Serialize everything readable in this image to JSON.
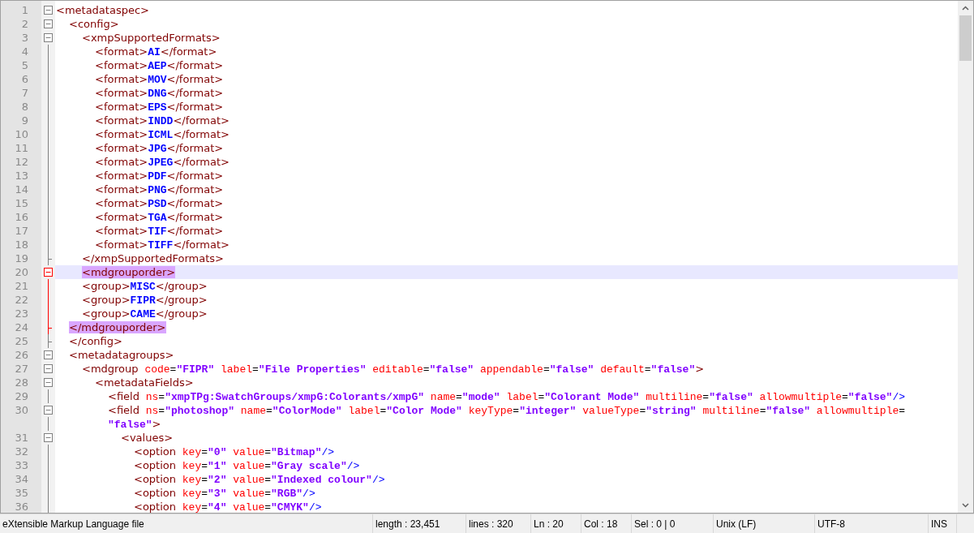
{
  "lines": [
    {
      "number": "1",
      "kind": "fold-open",
      "active": false,
      "selected": false,
      "tokens": [
        {
          "kind": "tag",
          "text": "<metadataspec>"
        }
      ],
      "children": [
        {
          "number": "2",
          "kind": "fold-open",
          "active": false,
          "selected": false,
          "tokens": [
            {
              "kind": "tag",
              "text": "<config>"
            }
          ],
          "children": [
            {
              "number": "3",
              "kind": "fold-open",
              "active": false,
              "selected": false,
              "tokens": [
                {
                  "kind": "tag",
                  "text": "<xmpSupportedFormats>"
                }
              ],
              "children": [
                {
                  "number": "4",
                  "kind": "fold-line",
                  "active": false,
                  "selected": false,
                  "tokens": [
                    {
                      "kind": "tag",
                      "text": "<format>"
                    },
                    {
                      "kind": "text",
                      "text": "AI"
                    },
                    {
                      "kind": "tag",
                      "text": "</format>"
                    }
                  ]
                },
                {
                  "number": "5",
                  "kind": "fold-line",
                  "active": false,
                  "selected": false,
                  "tokens": [
                    {
                      "kind": "tag",
                      "text": "<format>"
                    },
                    {
                      "kind": "text",
                      "text": "AEP"
                    },
                    {
                      "kind": "tag",
                      "text": "</format>"
                    }
                  ]
                },
                {
                  "number": "6",
                  "kind": "fold-line",
                  "active": false,
                  "selected": false,
                  "tokens": [
                    {
                      "kind": "tag",
                      "text": "<format>"
                    },
                    {
                      "kind": "text",
                      "text": "MOV"
                    },
                    {
                      "kind": "tag",
                      "text": "</format>"
                    }
                  ]
                },
                {
                  "number": "7",
                  "kind": "fold-line",
                  "active": false,
                  "selected": false,
                  "tokens": [
                    {
                      "kind": "tag",
                      "text": "<format>"
                    },
                    {
                      "kind": "text",
                      "text": "DNG"
                    },
                    {
                      "kind": "tag",
                      "text": "</format>"
                    }
                  ]
                },
                {
                  "number": "8",
                  "kind": "fold-line",
                  "active": false,
                  "selected": false,
                  "tokens": [
                    {
                      "kind": "tag",
                      "text": "<format>"
                    },
                    {
                      "kind": "text",
                      "text": "EPS"
                    },
                    {
                      "kind": "tag",
                      "text": "</format>"
                    }
                  ]
                },
                {
                  "number": "9",
                  "kind": "fold-line",
                  "active": false,
                  "selected": false,
                  "tokens": [
                    {
                      "kind": "tag",
                      "text": "<format>"
                    },
                    {
                      "kind": "text",
                      "text": "INDD"
                    },
                    {
                      "kind": "tag",
                      "text": "</format>"
                    }
                  ]
                },
                {
                  "number": "10",
                  "kind": "fold-line",
                  "active": false,
                  "selected": false,
                  "tokens": [
                    {
                      "kind": "tag",
                      "text": "<format>"
                    },
                    {
                      "kind": "text",
                      "text": "ICML"
                    },
                    {
                      "kind": "tag",
                      "text": "</format>"
                    }
                  ]
                },
                {
                  "number": "11",
                  "kind": "fold-line",
                  "active": false,
                  "selected": false,
                  "tokens": [
                    {
                      "kind": "tag",
                      "text": "<format>"
                    },
                    {
                      "kind": "text",
                      "text": "JPG"
                    },
                    {
                      "kind": "tag",
                      "text": "</format>"
                    }
                  ]
                },
                {
                  "number": "12",
                  "kind": "fold-line",
                  "active": false,
                  "selected": false,
                  "tokens": [
                    {
                      "kind": "tag",
                      "text": "<format>"
                    },
                    {
                      "kind": "text",
                      "text": "JPEG"
                    },
                    {
                      "kind": "tag",
                      "text": "</format>"
                    }
                  ]
                },
                {
                  "number": "13",
                  "kind": "fold-line",
                  "active": false,
                  "selected": false,
                  "tokens": [
                    {
                      "kind": "tag",
                      "text": "<format>"
                    },
                    {
                      "kind": "text",
                      "text": "PDF"
                    },
                    {
                      "kind": "tag",
                      "text": "</format>"
                    }
                  ]
                },
                {
                  "number": "14",
                  "kind": "fold-line",
                  "active": false,
                  "selected": false,
                  "tokens": [
                    {
                      "kind": "tag",
                      "text": "<format>"
                    },
                    {
                      "kind": "text",
                      "text": "PNG"
                    },
                    {
                      "kind": "tag",
                      "text": "</format>"
                    }
                  ]
                },
                {
                  "number": "15",
                  "kind": "fold-line",
                  "active": false,
                  "selected": false,
                  "tokens": [
                    {
                      "kind": "tag",
                      "text": "<format>"
                    },
                    {
                      "kind": "text",
                      "text": "PSD"
                    },
                    {
                      "kind": "tag",
                      "text": "</format>"
                    }
                  ]
                },
                {
                  "number": "16",
                  "kind": "fold-line",
                  "active": false,
                  "selected": false,
                  "tokens": [
                    {
                      "kind": "tag",
                      "text": "<format>"
                    },
                    {
                      "kind": "text",
                      "text": "TGA"
                    },
                    {
                      "kind": "tag",
                      "text": "</format>"
                    }
                  ]
                },
                {
                  "number": "17",
                  "kind": "fold-line",
                  "active": false,
                  "selected": false,
                  "tokens": [
                    {
                      "kind": "tag",
                      "text": "<format>"
                    },
                    {
                      "kind": "text",
                      "text": "TIF"
                    },
                    {
                      "kind": "tag",
                      "text": "</format>"
                    }
                  ]
                },
                {
                  "number": "18",
                  "kind": "fold-line",
                  "active": false,
                  "selected": false,
                  "tokens": [
                    {
                      "kind": "tag",
                      "text": "<format>"
                    },
                    {
                      "kind": "text",
                      "text": "TIFF"
                    },
                    {
                      "kind": "tag",
                      "text": "</format>"
                    }
                  ]
                }
              ]
            },
            {
              "number": "19",
              "kind": "fold-end",
              "active": false,
              "selected": false,
              "tokens": [
                {
                  "kind": "tag",
                  "text": "</xmpSupportedFormats>"
                }
              ]
            },
            {
              "number": "20",
              "kind": "fold-open",
              "active": true,
              "selected": true,
              "tokens": [
                {
                  "kind": "tag",
                  "text": "<mdgrouporder>",
                  "matched": true
                }
              ]
            },
            {
              "number": "21",
              "kind": "fold-line",
              "active": true,
              "selected": false,
              "tokens": [
                {
                  "kind": "tag",
                  "text": "<group>"
                },
                {
                  "kind": "text",
                  "text": "MISC"
                },
                {
                  "kind": "tag",
                  "text": "</group>"
                }
              ]
            },
            {
              "number": "22",
              "kind": "fold-line",
              "active": true,
              "selected": false,
              "tokens": [
                {
                  "kind": "tag",
                  "text": "<group>"
                },
                {
                  "kind": "text",
                  "text": "FIPR"
                },
                {
                  "kind": "tag",
                  "text": "</group>"
                }
              ]
            },
            {
              "number": "23",
              "kind": "fold-line",
              "active": true,
              "selected": false,
              "tokens": [
                {
                  "kind": "tag",
                  "text": "<group>"
                },
                {
                  "kind": "text",
                  "text": "CAME"
                },
                {
                  "kind": "tag",
                  "text": "</group>"
                }
              ]
            }
          ]
        },
        {
          "number": "24",
          "kind": "fold-end",
          "active": true,
          "selected": false,
          "tokens": [
            {
              "kind": "tag",
              "text": "</mdgrouporder>",
              "matched": true
            }
          ]
        },
        {
          "number": "25",
          "kind": "fold-end",
          "active": false,
          "selected": false,
          "tokens": [
            {
              "kind": "tag",
              "text": "</config>"
            }
          ]
        },
        {
          "number": "26",
          "kind": "fold-open",
          "active": false,
          "selected": false,
          "tokens": [
            {
              "kind": "tag",
              "text": "<metadatagroups>"
            }
          ],
          "children": [
            {
              "number": "27",
              "kind": "fold-open",
              "active": false,
              "selected": false,
              "tokens": [
                {
                  "kind": "tag",
                  "text": "<mdgroup"
                },
                {
                  "kind": "attr",
                  "text": " code"
                },
                {
                  "kind": "eq",
                  "text": "="
                },
                {
                  "kind": "value",
                  "text": "\"FIPR\""
                },
                {
                  "kind": "attr",
                  "text": " label"
                },
                {
                  "kind": "eq",
                  "text": "="
                },
                {
                  "kind": "value",
                  "text": "\"File Properties\""
                },
                {
                  "kind": "attr",
                  "text": " editable"
                },
                {
                  "kind": "eq",
                  "text": "="
                },
                {
                  "kind": "value",
                  "text": "\"false\""
                },
                {
                  "kind": "attr",
                  "text": " appendable"
                },
                {
                  "kind": "eq",
                  "text": "="
                },
                {
                  "kind": "value",
                  "text": "\"false\""
                },
                {
                  "kind": "attr",
                  "text": " default"
                },
                {
                  "kind": "eq",
                  "text": "="
                },
                {
                  "kind": "value",
                  "text": "\"false\""
                },
                {
                  "kind": "tag",
                  "text": ">"
                }
              ],
              "children": [
                {
                  "number": "28",
                  "kind": "fold-open",
                  "active": false,
                  "selected": false,
                  "tokens": [
                    {
                      "kind": "tag",
                      "text": "<metadataFields>"
                    }
                  ],
                  "children": [
                    {
                      "number": "29",
                      "kind": "fold-line",
                      "active": false,
                      "selected": false,
                      "tokens": [
                        {
                          "kind": "tag",
                          "text": "<field"
                        },
                        {
                          "kind": "attr",
                          "text": " ns"
                        },
                        {
                          "kind": "eq",
                          "text": "="
                        },
                        {
                          "kind": "value",
                          "text": "\"xmpTPg:SwatchGroups/xmpG:Colorants/xmpG\""
                        },
                        {
                          "kind": "attr",
                          "text": " name"
                        },
                        {
                          "kind": "eq",
                          "text": "="
                        },
                        {
                          "kind": "value",
                          "text": "\"mode\""
                        },
                        {
                          "kind": "attr",
                          "text": " label"
                        },
                        {
                          "kind": "eq",
                          "text": "="
                        },
                        {
                          "kind": "value",
                          "text": "\"Colorant Mode\""
                        },
                        {
                          "kind": "attr",
                          "text": " multiline"
                        },
                        {
                          "kind": "eq",
                          "text": "="
                        },
                        {
                          "kind": "value",
                          "text": "\"false\""
                        },
                        {
                          "kind": "attr",
                          "text": " allowmultiple"
                        },
                        {
                          "kind": "eq",
                          "text": "="
                        },
                        {
                          "kind": "value",
                          "text": "\"false\""
                        },
                        {
                          "kind": "close",
                          "text": "/>"
                        }
                      ]
                    },
                    {
                      "number": "30",
                      "kind": "fold-open",
                      "active": false,
                      "selected": false,
                      "tokens": [
                        {
                          "kind": "tag",
                          "text": "<field"
                        },
                        {
                          "kind": "attr",
                          "text": " ns"
                        },
                        {
                          "kind": "eq",
                          "text": "="
                        },
                        {
                          "kind": "value",
                          "text": "\"photoshop\""
                        },
                        {
                          "kind": "attr",
                          "text": " name"
                        },
                        {
                          "kind": "eq",
                          "text": "="
                        },
                        {
                          "kind": "value",
                          "text": "\"ColorMode\""
                        },
                        {
                          "kind": "attr",
                          "text": " label"
                        },
                        {
                          "kind": "eq",
                          "text": "="
                        },
                        {
                          "kind": "value",
                          "text": "\"Color Mode\""
                        },
                        {
                          "kind": "attr",
                          "text": " keyType"
                        },
                        {
                          "kind": "eq",
                          "text": "="
                        },
                        {
                          "kind": "value",
                          "text": "\"integer\""
                        },
                        {
                          "kind": "attr",
                          "text": " valueType"
                        },
                        {
                          "kind": "eq",
                          "text": "="
                        },
                        {
                          "kind": "value",
                          "text": "\"string\""
                        },
                        {
                          "kind": "attr",
                          "text": " multiline"
                        },
                        {
                          "kind": "eq",
                          "text": "="
                        },
                        {
                          "kind": "value",
                          "text": "\"false\""
                        },
                        {
                          "kind": "attr",
                          "text": " allowmultiple"
                        },
                        {
                          "kind": "eq",
                          "text": "="
                        }
                      ],
                      "wrap_tokens": [
                        {
                          "kind": "value",
                          "text": "\"false\""
                        },
                        {
                          "kind": "tag",
                          "text": ">"
                        }
                      ],
                      "children": [
                        {
                          "number": "31",
                          "kind": "fold-open",
                          "active": false,
                          "selected": false,
                          "tokens": [
                            {
                              "kind": "tag",
                              "text": "<values>"
                            }
                          ],
                          "children": [
                            {
                              "number": "32",
                              "kind": "fold-line",
                              "active": false,
                              "selected": false,
                              "tokens": [
                                {
                                  "kind": "tag",
                                  "text": "<option"
                                },
                                {
                                  "kind": "attr",
                                  "text": " key"
                                },
                                {
                                  "kind": "eq",
                                  "text": "="
                                },
                                {
                                  "kind": "value",
                                  "text": "\"0\""
                                },
                                {
                                  "kind": "attr",
                                  "text": " value"
                                },
                                {
                                  "kind": "eq",
                                  "text": "="
                                },
                                {
                                  "kind": "value",
                                  "text": "\"Bitmap\""
                                },
                                {
                                  "kind": "close",
                                  "text": "/>"
                                }
                              ]
                            },
                            {
                              "number": "33",
                              "kind": "fold-line",
                              "active": false,
                              "selected": false,
                              "tokens": [
                                {
                                  "kind": "tag",
                                  "text": "<option"
                                },
                                {
                                  "kind": "attr",
                                  "text": " key"
                                },
                                {
                                  "kind": "eq",
                                  "text": "="
                                },
                                {
                                  "kind": "value",
                                  "text": "\"1\""
                                },
                                {
                                  "kind": "attr",
                                  "text": " value"
                                },
                                {
                                  "kind": "eq",
                                  "text": "="
                                },
                                {
                                  "kind": "value",
                                  "text": "\"Gray scale\""
                                },
                                {
                                  "kind": "close",
                                  "text": "/>"
                                }
                              ]
                            },
                            {
                              "number": "34",
                              "kind": "fold-line",
                              "active": false,
                              "selected": false,
                              "tokens": [
                                {
                                  "kind": "tag",
                                  "text": "<option"
                                },
                                {
                                  "kind": "attr",
                                  "text": " key"
                                },
                                {
                                  "kind": "eq",
                                  "text": "="
                                },
                                {
                                  "kind": "value",
                                  "text": "\"2\""
                                },
                                {
                                  "kind": "attr",
                                  "text": " value"
                                },
                                {
                                  "kind": "eq",
                                  "text": "="
                                },
                                {
                                  "kind": "value",
                                  "text": "\"Indexed colour\""
                                },
                                {
                                  "kind": "close",
                                  "text": "/>"
                                }
                              ]
                            },
                            {
                              "number": "35",
                              "kind": "fold-line",
                              "active": false,
                              "selected": false,
                              "tokens": [
                                {
                                  "kind": "tag",
                                  "text": "<option"
                                },
                                {
                                  "kind": "attr",
                                  "text": " key"
                                },
                                {
                                  "kind": "eq",
                                  "text": "="
                                },
                                {
                                  "kind": "value",
                                  "text": "\"3\""
                                },
                                {
                                  "kind": "attr",
                                  "text": " value"
                                },
                                {
                                  "kind": "eq",
                                  "text": "="
                                },
                                {
                                  "kind": "value",
                                  "text": "\"RGB\""
                                },
                                {
                                  "kind": "close",
                                  "text": "/>"
                                }
                              ]
                            },
                            {
                              "number": "36",
                              "kind": "fold-line",
                              "active": false,
                              "selected": false,
                              "tokens": [
                                {
                                  "kind": "tag",
                                  "text": "<option"
                                },
                                {
                                  "kind": "attr",
                                  "text": " key"
                                },
                                {
                                  "kind": "eq",
                                  "text": "="
                                },
                                {
                                  "kind": "value",
                                  "text": "\"4\""
                                },
                                {
                                  "kind": "attr",
                                  "text": " value"
                                },
                                {
                                  "kind": "eq",
                                  "text": "="
                                },
                                {
                                  "kind": "value",
                                  "text": "\"CMYK\""
                                },
                                {
                                  "kind": "close",
                                  "text": "/>"
                                }
                              ]
                            }
                          ]
                        }
                      ]
                    }
                  ]
                }
              ]
            }
          ]
        }
      ]
    }
  ],
  "status_bar": {
    "file_type": "eXtensible Markup Language file",
    "length": "length : 23,451",
    "lines": "lines : 320",
    "ln": "Ln : 20",
    "col": "Col : 18",
    "sel": "Sel : 0 | 0",
    "eol": "Unix (LF)",
    "encoding": "UTF-8",
    "mode": "INS"
  }
}
